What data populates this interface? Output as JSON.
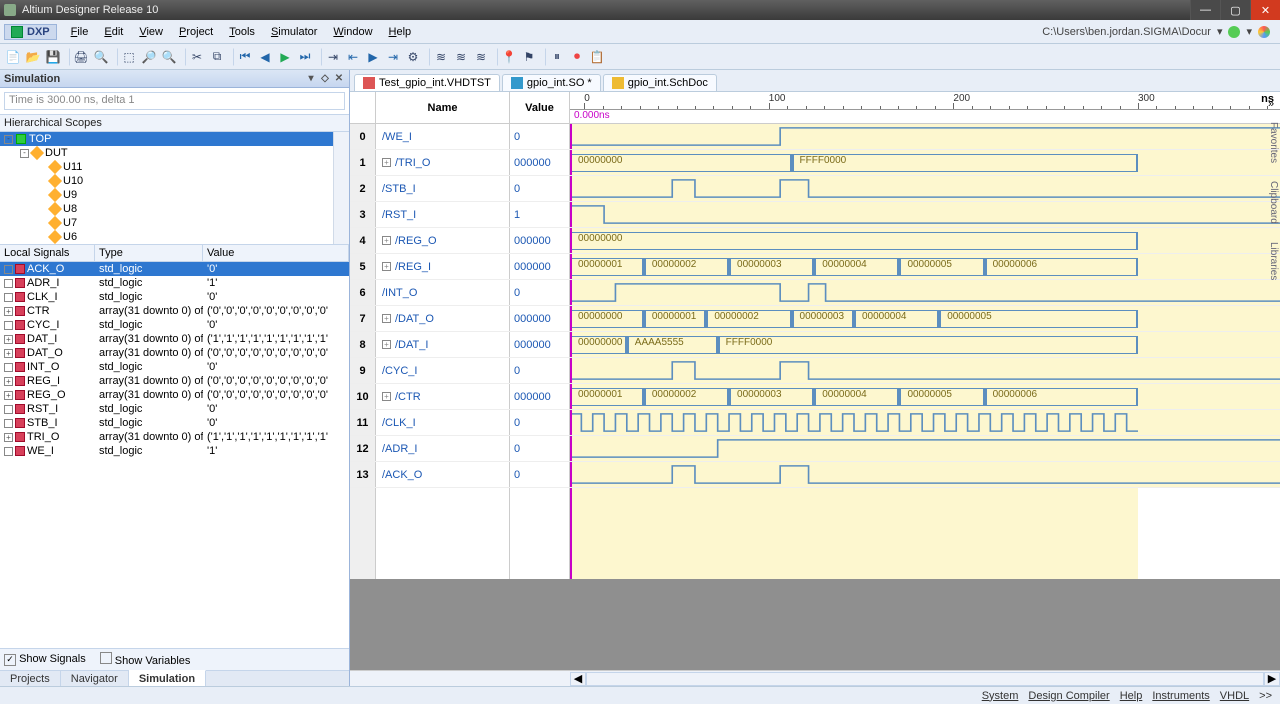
{
  "title": "Altium Designer Release 10",
  "dxp": "DXP",
  "path": "C:\\Users\\ben.jordan.SIGMA\\Docur",
  "menu": [
    "File",
    "Edit",
    "View",
    "Project",
    "Tools",
    "Simulator",
    "Window",
    "Help"
  ],
  "panel": {
    "title": "Simulation",
    "time": "Time is 300.00 ns, delta 1",
    "hier": "Hierarchical Scopes"
  },
  "tree": [
    {
      "lvl": 0,
      "exp": "-",
      "icon": "g",
      "label": "TOP",
      "sel": true
    },
    {
      "lvl": 1,
      "exp": "-",
      "icon": "d",
      "label": "DUT"
    },
    {
      "lvl": 2,
      "exp": "",
      "icon": "d",
      "label": "U11"
    },
    {
      "lvl": 2,
      "exp": "",
      "icon": "d",
      "label": "U10"
    },
    {
      "lvl": 2,
      "exp": "",
      "icon": "d",
      "label": "U9"
    },
    {
      "lvl": 2,
      "exp": "",
      "icon": "d",
      "label": "U8"
    },
    {
      "lvl": 2,
      "exp": "",
      "icon": "d",
      "label": "U7"
    },
    {
      "lvl": 2,
      "exp": "",
      "icon": "d",
      "label": "U6"
    }
  ],
  "sigHead": {
    "c1": "Local Signals",
    "c2": "Type",
    "c3": "Value"
  },
  "signals": [
    {
      "n": "ACK_O",
      "t": "std_logic",
      "v": "'0'",
      "sel": true,
      "exp": ""
    },
    {
      "n": "ADR_I",
      "t": "std_logic",
      "v": "'1'",
      "exp": ""
    },
    {
      "n": "CLK_I",
      "t": "std_logic",
      "v": "'0'",
      "exp": ""
    },
    {
      "n": "CTR",
      "t": "array(31 downto 0) of :",
      "v": "('0','0','0','0','0','0','0','0','0'",
      "exp": "+"
    },
    {
      "n": "CYC_I",
      "t": "std_logic",
      "v": "'0'",
      "exp": ""
    },
    {
      "n": "DAT_I",
      "t": "array(31 downto 0) of :",
      "v": "('1','1','1','1','1','1','1','1','1'",
      "exp": "+"
    },
    {
      "n": "DAT_O",
      "t": "array(31 downto 0) of :",
      "v": "('0','0','0','0','0','0','0','0','0'",
      "exp": "+"
    },
    {
      "n": "INT_O",
      "t": "std_logic",
      "v": "'0'",
      "exp": ""
    },
    {
      "n": "REG_I",
      "t": "array(31 downto 0) of :",
      "v": "('0','0','0','0','0','0','0','0','0'",
      "exp": "+"
    },
    {
      "n": "REG_O",
      "t": "array(31 downto 0) of :",
      "v": "('0','0','0','0','0','0','0','0','0'",
      "exp": "+"
    },
    {
      "n": "RST_I",
      "t": "std_logic",
      "v": "'0'",
      "exp": ""
    },
    {
      "n": "STB_I",
      "t": "std_logic",
      "v": "'0'",
      "exp": ""
    },
    {
      "n": "TRI_O",
      "t": "array(31 downto 0) of :",
      "v": "('1','1','1','1','1','1','1','1','1'",
      "exp": "+"
    },
    {
      "n": "WE_I",
      "t": "std_logic",
      "v": "'1'",
      "exp": ""
    }
  ],
  "showSig": "Show Signals",
  "showVar": "Show Variables",
  "bottomTabs": [
    "Projects",
    "Navigator",
    "Simulation"
  ],
  "docTabs": [
    {
      "label": "Test_gpio_int.VHDTST",
      "c": "#d55",
      "act": true
    },
    {
      "label": "gpio_int.SO *",
      "c": "#39c"
    },
    {
      "label": "gpio_int.SchDoc",
      "c": "#eb3"
    }
  ],
  "wave": {
    "nameH": "Name",
    "valH": "Value",
    "ticks": [
      "0",
      "100",
      "200",
      "300"
    ],
    "unit": "ns",
    "cursor": "0.000ns",
    "rows": [
      {
        "i": "0",
        "n": "/WE_I",
        "v": "0",
        "type": "l",
        "edges": [
          [
            0,
            0
          ],
          [
            37,
            1
          ]
        ]
      },
      {
        "i": "1",
        "n": "/TRI_O",
        "v": "000000",
        "type": "b",
        "exp": "+",
        "segs": [
          [
            0,
            39,
            "00000000"
          ],
          [
            39,
            100,
            "FFFF0000"
          ]
        ]
      },
      {
        "i": "2",
        "n": "/STB_I",
        "v": "0",
        "type": "l",
        "edges": [
          [
            0,
            0
          ],
          [
            18,
            1
          ],
          [
            22,
            0
          ],
          [
            37,
            1
          ],
          [
            42,
            0
          ]
        ]
      },
      {
        "i": "3",
        "n": "/RST_I",
        "v": "1",
        "type": "l",
        "edges": [
          [
            0,
            1
          ],
          [
            6,
            0
          ]
        ]
      },
      {
        "i": "4",
        "n": "/REG_O",
        "v": "000000",
        "type": "b",
        "exp": "+",
        "segs": [
          [
            0,
            100,
            "00000000"
          ]
        ]
      },
      {
        "i": "5",
        "n": "/REG_I",
        "v": "000000",
        "type": "b",
        "exp": "+",
        "segs": [
          [
            0,
            13,
            "00000001"
          ],
          [
            13,
            28,
            "00000002"
          ],
          [
            28,
            43,
            "00000003"
          ],
          [
            43,
            58,
            "00000004"
          ],
          [
            58,
            73,
            "00000005"
          ],
          [
            73,
            100,
            "00000006"
          ]
        ]
      },
      {
        "i": "6",
        "n": "/INT_O",
        "v": "0",
        "type": "l",
        "edges": [
          [
            0,
            0
          ],
          [
            8,
            1
          ],
          [
            37,
            0
          ],
          [
            42,
            1
          ],
          [
            45,
            0
          ]
        ]
      },
      {
        "i": "7",
        "n": "/DAT_O",
        "v": "000000",
        "type": "b",
        "exp": "+",
        "segs": [
          [
            0,
            13,
            "00000000"
          ],
          [
            13,
            24,
            "00000001"
          ],
          [
            24,
            39,
            "00000002"
          ],
          [
            39,
            50,
            "00000003"
          ],
          [
            50,
            65,
            "00000004"
          ],
          [
            65,
            100,
            "00000005"
          ]
        ]
      },
      {
        "i": "8",
        "n": "/DAT_I",
        "v": "000000",
        "type": "b",
        "exp": "+",
        "segs": [
          [
            0,
            10,
            "00000000"
          ],
          [
            10,
            26,
            "AAAA5555"
          ],
          [
            26,
            100,
            "FFFF0000"
          ]
        ]
      },
      {
        "i": "9",
        "n": "/CYC_I",
        "v": "0",
        "type": "l",
        "edges": [
          [
            0,
            0
          ],
          [
            18,
            1
          ],
          [
            22,
            0
          ],
          [
            37,
            1
          ],
          [
            42,
            0
          ]
        ]
      },
      {
        "i": "10",
        "n": "/CTR",
        "v": "000000",
        "type": "b",
        "exp": "+",
        "segs": [
          [
            0,
            13,
            "00000001"
          ],
          [
            13,
            28,
            "00000002"
          ],
          [
            28,
            43,
            "00000003"
          ],
          [
            43,
            58,
            "00000004"
          ],
          [
            58,
            73,
            "00000005"
          ],
          [
            73,
            100,
            "00000006"
          ]
        ]
      },
      {
        "i": "11",
        "n": "/CLK_I",
        "v": "0",
        "type": "clk"
      },
      {
        "i": "12",
        "n": "/ADR_I",
        "v": "0",
        "type": "l",
        "edges": [
          [
            0,
            0
          ],
          [
            26,
            1
          ]
        ]
      },
      {
        "i": "13",
        "n": "/ACK_O",
        "v": "0",
        "type": "l",
        "edges": [
          [
            0,
            0
          ],
          [
            18,
            1
          ],
          [
            22,
            0
          ],
          [
            37,
            1
          ],
          [
            42,
            0
          ]
        ]
      }
    ]
  },
  "sideTabs": [
    "Favorites",
    "Clipboard",
    "Libraries"
  ],
  "status": [
    "System",
    "Design Compiler",
    "Help",
    "Instruments",
    "VHDL",
    ">>"
  ]
}
